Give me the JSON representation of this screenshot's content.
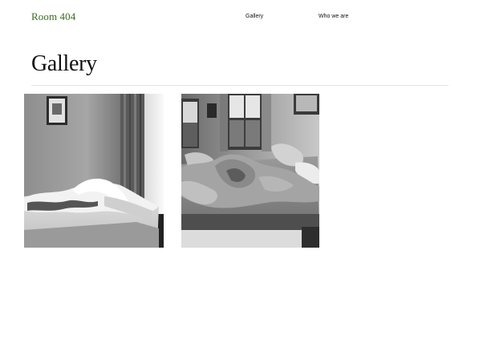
{
  "header": {
    "logo": "Room 404",
    "nav": [
      {
        "label": "Gallery"
      },
      {
        "label": "Who we are"
      }
    ]
  },
  "main": {
    "title": "Gallery",
    "photos": [
      {
        "subject": "black and white photo of an unmade single bed beside a window with a framed picture on the wall"
      },
      {
        "subject": "black and white photo of an unmade double bed with rumpled pillows in front of a window"
      }
    ]
  },
  "colors": {
    "logo": "#3a6b21",
    "text": "#111111",
    "rule": "#e4e4e4",
    "background": "#ffffff"
  }
}
